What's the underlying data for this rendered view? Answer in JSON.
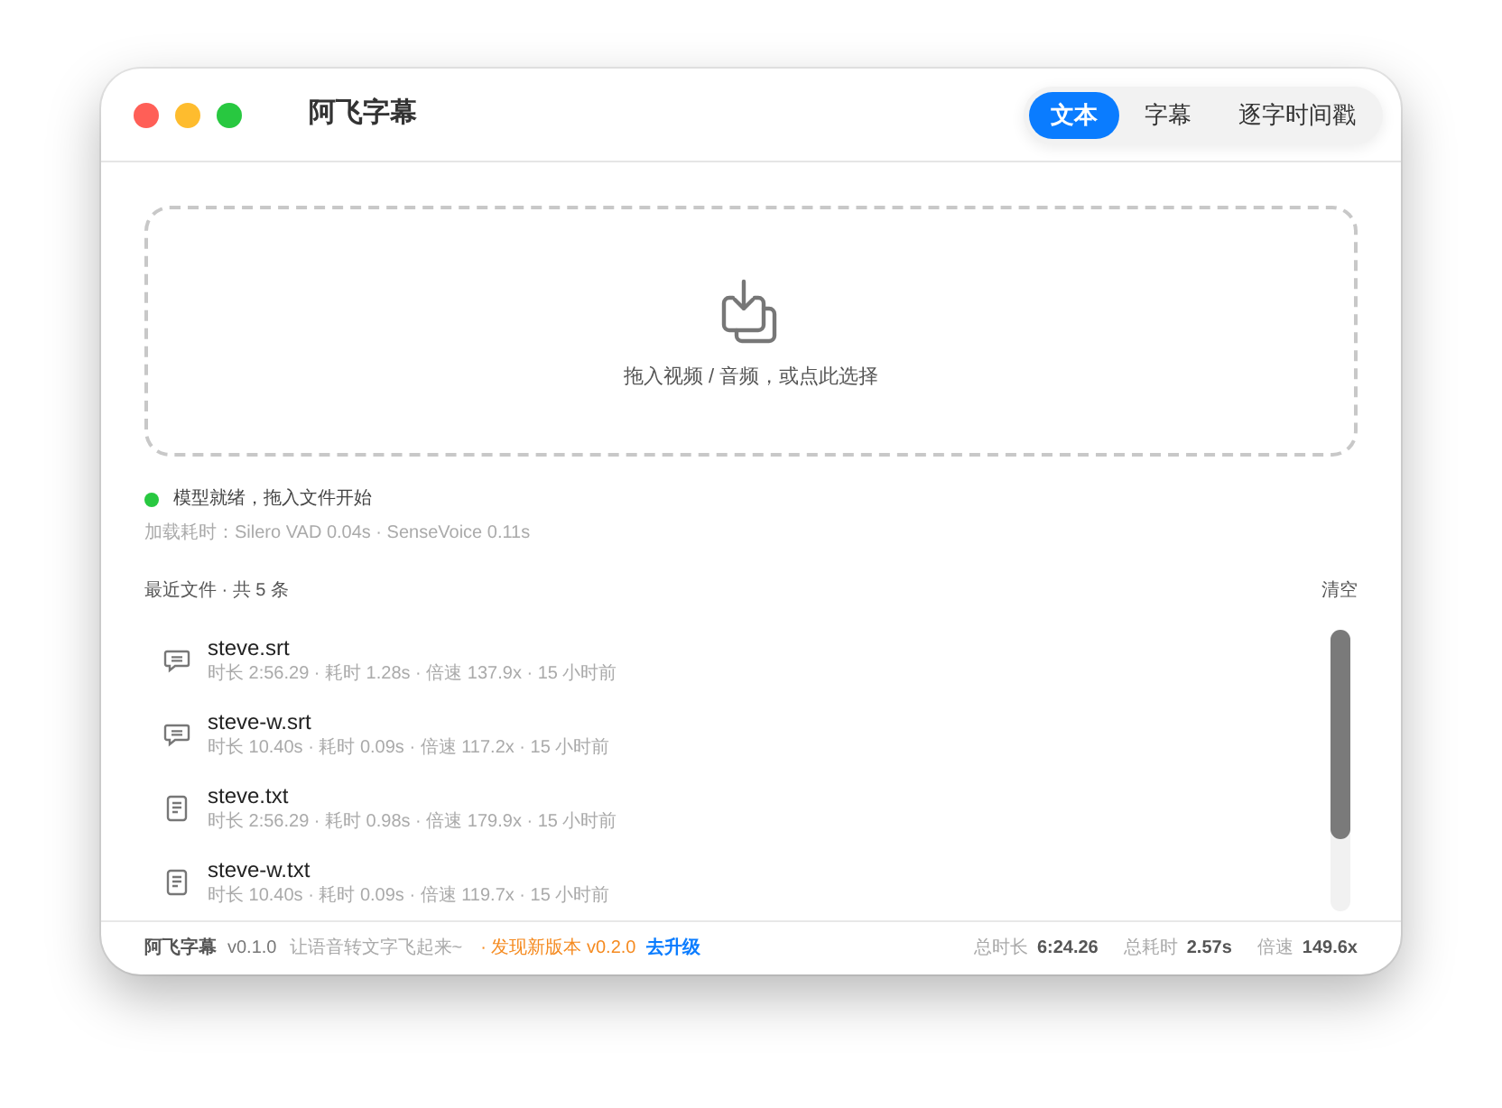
{
  "window": {
    "title": "阿飞字幕"
  },
  "tabs": [
    {
      "label": "文本",
      "selected": true
    },
    {
      "label": "字幕",
      "selected": false
    },
    {
      "label": "逐字时间戳",
      "selected": false
    }
  ],
  "drop_zone": {
    "label": "拖入视频 / 音频，或点此选择"
  },
  "status": {
    "ready": true,
    "message": "模型就绪，拖入文件开始",
    "load_times": "加载耗时：Silero VAD 0.04s · SenseVoice 0.11s"
  },
  "recent": {
    "heading": "最近文件 · 共 5 条",
    "clear": "清空",
    "files": [
      {
        "kind": "subtitle",
        "name": "steve.srt",
        "meta": "时长 2:56.29 · 耗时 1.28s · 倍速 137.9x · 15 小时前"
      },
      {
        "kind": "subtitle",
        "name": "steve-w.srt",
        "meta": "时长 10.40s · 耗时 0.09s · 倍速 117.2x · 15 小时前"
      },
      {
        "kind": "text",
        "name": "steve.txt",
        "meta": "时长 2:56.29 · 耗时 0.98s · 倍速 179.9x · 15 小时前"
      },
      {
        "kind": "text",
        "name": "steve-w.txt",
        "meta": "时长 10.40s · 耗时 0.09s · 倍速 119.7x · 15 小时前"
      }
    ]
  },
  "footer": {
    "app_name": "阿飞字幕",
    "version": "v0.1.0",
    "tagline": "让语音转文字飞起来~",
    "update_notice": "· 发现新版本 v0.2.0",
    "upgrade_link": "去升级",
    "stats": [
      {
        "label": "总时长",
        "value": "6:24.26"
      },
      {
        "label": "总耗时",
        "value": "2.57s"
      },
      {
        "label": "倍速",
        "value": "149.6x"
      }
    ]
  }
}
